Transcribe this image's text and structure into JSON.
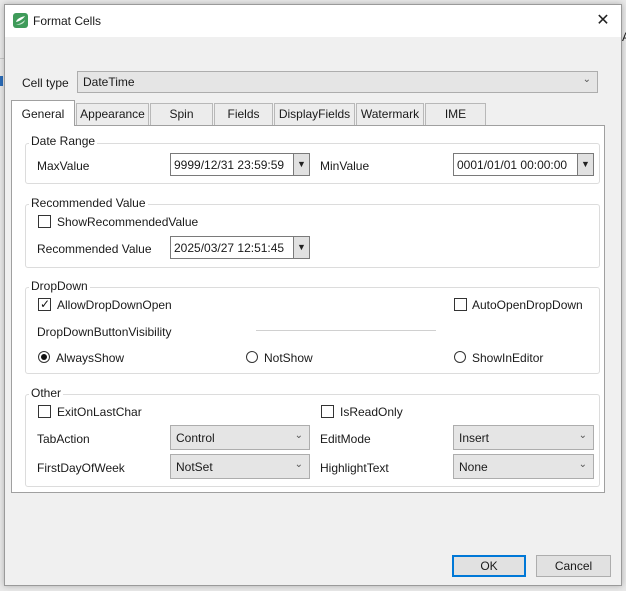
{
  "window": {
    "title": "Format Cells",
    "close_label": "✕"
  },
  "cell_type": {
    "label": "Cell type",
    "value": "DateTime"
  },
  "tabs": [
    {
      "label": "General",
      "active": true
    },
    {
      "label": "Appearance"
    },
    {
      "label": "Spin"
    },
    {
      "label": "Fields"
    },
    {
      "label": "DisplayFields"
    },
    {
      "label": "Watermark"
    },
    {
      "label": "IME"
    }
  ],
  "date_range": {
    "title": "Date Range",
    "max_label": "MaxValue",
    "max_value": "9999/12/31 23:59:59",
    "min_label": "MinValue",
    "min_value": "0001/01/01 00:00:00"
  },
  "recommended": {
    "title": "Recommended Value",
    "show_label": "ShowRecommendedValue",
    "value_label": "Recommended Value",
    "value": "2025/03/27 12:51:45"
  },
  "dropdown": {
    "title": "DropDown",
    "allow_open_label": "AllowDropDownOpen",
    "auto_open_label": "AutoOpenDropDown",
    "visibility_label": "DropDownButtonVisibility",
    "options": [
      "AlwaysShow",
      "NotShow",
      "ShowInEditor"
    ],
    "selected": "AlwaysShow"
  },
  "other": {
    "title": "Other",
    "exit_label": "ExitOnLastChar",
    "readonly_label": "IsReadOnly",
    "tab_action_label": "TabAction",
    "tab_action_value": "Control",
    "edit_mode_label": "EditMode",
    "edit_mode_value": "Insert",
    "first_day_label": "FirstDayOfWeek",
    "first_day_value": "NotSet",
    "highlight_label": "HighlightText",
    "highlight_value": "None"
  },
  "buttons": {
    "ok": "OK",
    "cancel": "Cancel"
  },
  "colors": {
    "accent": "#0078d7",
    "logo": "#3f9b5a"
  }
}
